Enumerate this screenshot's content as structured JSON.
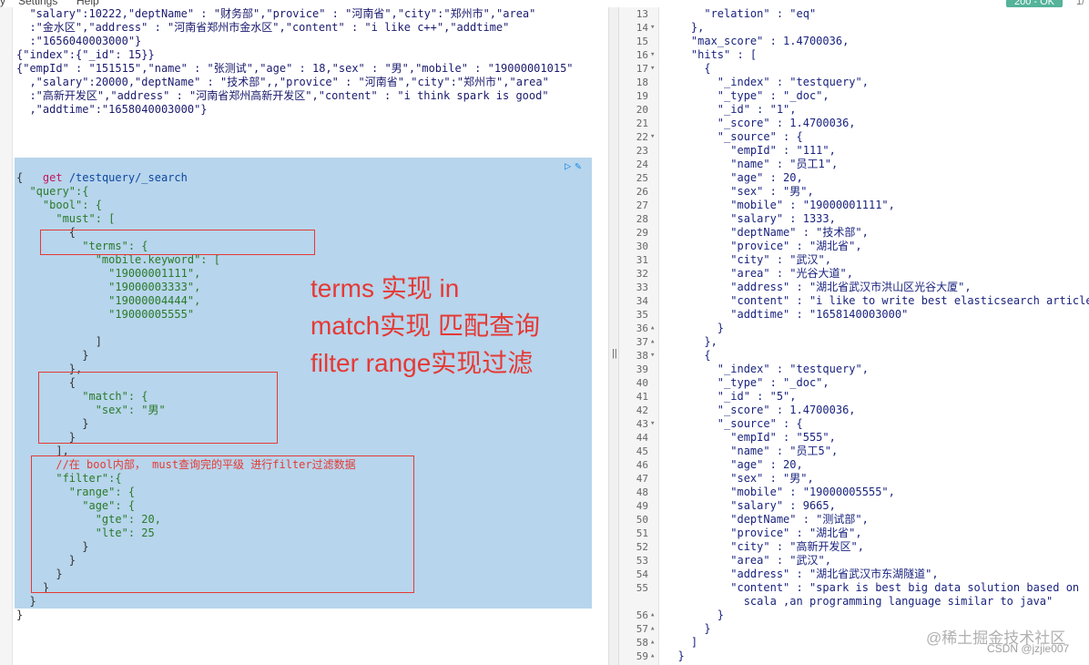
{
  "menubar": {
    "fragment": "y",
    "settings": "Settings",
    "help": "Help"
  },
  "status": {
    "badge": "200 - OK",
    "fragment": "1/"
  },
  "left": {
    "gutter_numbers": [
      "",
      "",
      "",
      "",
      "",
      "",
      "",
      "",
      "",
      "",
      "",
      "",
      "",
      "",
      "",
      "",
      "",
      "",
      "",
      "",
      "",
      "",
      "",
      "",
      "",
      "",
      "",
      "",
      "",
      "",
      "",
      "",
      "",
      "",
      "",
      "",
      "",
      "",
      "",
      "",
      "",
      "",
      "",
      "",
      ""
    ],
    "top_lines": [
      "  \"salary\":10222,\"deptName\" : \"财务部\",\"provice\" : \"河南省\",\"city\":\"郑州市\",\"area\"",
      "  :\"金水区\",\"address\" : \"河南省郑州市金水区\",\"content\" : \"i like c++\",\"addtime\"",
      "  :\"1656040003000\"}",
      "{\"index\":{\"_id\": 15}}",
      "{\"empId\" : \"151515\",\"name\" : \"张测试\",\"age\" : 18,\"sex\" : \"男\",\"mobile\" : \"19000001015\"",
      "  ,\"salary\":20000,\"deptName\" : \"技术部\",,\"provice\" : \"河南省\",\"city\":\"郑州市\",\"area\"",
      "  :\"高新开发区\",\"address\" : \"河南省郑州高新开发区\",\"content\" : \"i think spark is good\"",
      "  ,\"addtime\":\"1658040003000\"}"
    ],
    "request": {
      "method": "get",
      "url": " /testquery/_search"
    },
    "query_lines": [
      "{",
      "  \"query\":{",
      "    \"bool\": {",
      "      \"must\": [",
      "        {",
      "          \"terms\": {",
      "            \"mobile.keyword\": [",
      "              \"19000001111\",",
      "              \"19000003333\",",
      "              \"19000004444\",",
      "              \"19000005555\"",
      "",
      "            ]",
      "          }",
      "        },",
      "        {",
      "          \"match\": {",
      "            \"sex\": \"男\"",
      "          }",
      "        }",
      "      ],",
      "      //在 bool内部， must查询完的平级 进行filter过滤数据",
      "      \"filter\":{",
      "        \"range\": {",
      "          \"age\": {",
      "            \"gte\": 20,",
      "            \"lte\": 25",
      "          }",
      "        }",
      "      }",
      "    }",
      "  }",
      "}"
    ],
    "annotations": [
      "terms 实现 in",
      "match实现 匹配查询",
      "filter range实现过滤"
    ],
    "icons": {
      "run": "play-icon",
      "wrench": "wrench-icon"
    }
  },
  "right": {
    "lines": [
      {
        "num": "13",
        "fold": "",
        "text": "      \"relation\" : \"eq\""
      },
      {
        "num": "14",
        "fold": "▾",
        "text": "    },"
      },
      {
        "num": "15",
        "fold": "",
        "text": "    \"max_score\" : 1.4700036,"
      },
      {
        "num": "16",
        "fold": "▾",
        "text": "    \"hits\" : ["
      },
      {
        "num": "17",
        "fold": "▾",
        "text": "      {"
      },
      {
        "num": "18",
        "fold": "",
        "text": "        \"_index\" : \"testquery\","
      },
      {
        "num": "19",
        "fold": "",
        "text": "        \"_type\" : \"_doc\","
      },
      {
        "num": "20",
        "fold": "",
        "text": "        \"_id\" : \"1\","
      },
      {
        "num": "21",
        "fold": "",
        "text": "        \"_score\" : 1.4700036,"
      },
      {
        "num": "22",
        "fold": "▾",
        "text": "        \"_source\" : {"
      },
      {
        "num": "23",
        "fold": "",
        "text": "          \"empId\" : \"111\","
      },
      {
        "num": "24",
        "fold": "",
        "text": "          \"name\" : \"员工1\","
      },
      {
        "num": "25",
        "fold": "",
        "text": "          \"age\" : 20,"
      },
      {
        "num": "26",
        "fold": "",
        "text": "          \"sex\" : \"男\","
      },
      {
        "num": "27",
        "fold": "",
        "text": "          \"mobile\" : \"19000001111\","
      },
      {
        "num": "28",
        "fold": "",
        "text": "          \"salary\" : 1333,"
      },
      {
        "num": "29",
        "fold": "",
        "text": "          \"deptName\" : \"技术部\","
      },
      {
        "num": "30",
        "fold": "",
        "text": "          \"provice\" : \"湖北省\","
      },
      {
        "num": "31",
        "fold": "",
        "text": "          \"city\" : \"武汉\","
      },
      {
        "num": "32",
        "fold": "",
        "text": "          \"area\" : \"光谷大道\","
      },
      {
        "num": "33",
        "fold": "",
        "text": "          \"address\" : \"湖北省武汉市洪山区光谷大厦\","
      },
      {
        "num": "34",
        "fold": "",
        "text": "          \"content\" : \"i like to write best elasticsearch article\","
      },
      {
        "num": "35",
        "fold": "",
        "text": "          \"addtime\" : \"1658140003000\""
      },
      {
        "num": "36",
        "fold": "▴",
        "text": "        }"
      },
      {
        "num": "37",
        "fold": "▴",
        "text": "      },"
      },
      {
        "num": "38",
        "fold": "▾",
        "text": "      {"
      },
      {
        "num": "39",
        "fold": "",
        "text": "        \"_index\" : \"testquery\","
      },
      {
        "num": "40",
        "fold": "",
        "text": "        \"_type\" : \"_doc\","
      },
      {
        "num": "41",
        "fold": "",
        "text": "        \"_id\" : \"5\","
      },
      {
        "num": "42",
        "fold": "",
        "text": "        \"_score\" : 1.4700036,"
      },
      {
        "num": "43",
        "fold": "▾",
        "text": "        \"_source\" : {"
      },
      {
        "num": "44",
        "fold": "",
        "text": "          \"empId\" : \"555\","
      },
      {
        "num": "45",
        "fold": "",
        "text": "          \"name\" : \"员工5\","
      },
      {
        "num": "46",
        "fold": "",
        "text": "          \"age\" : 20,"
      },
      {
        "num": "47",
        "fold": "",
        "text": "          \"sex\" : \"男\","
      },
      {
        "num": "48",
        "fold": "",
        "text": "          \"mobile\" : \"19000005555\","
      },
      {
        "num": "49",
        "fold": "",
        "text": "          \"salary\" : 9665,"
      },
      {
        "num": "50",
        "fold": "",
        "text": "          \"deptName\" : \"测试部\","
      },
      {
        "num": "51",
        "fold": "",
        "text": "          \"provice\" : \"湖北省\","
      },
      {
        "num": "52",
        "fold": "",
        "text": "          \"city\" : \"高新开发区\","
      },
      {
        "num": "53",
        "fold": "",
        "text": "          \"area\" : \"武汉\","
      },
      {
        "num": "54",
        "fold": "",
        "text": "          \"address\" : \"湖北省武汉市东湖隧道\","
      },
      {
        "num": "55",
        "fold": "",
        "text": "          \"content\" : \"spark is best big data solution based on"
      },
      {
        "num": "",
        "fold": "",
        "text": "            scala ,an programming language similar to java\""
      },
      {
        "num": "56",
        "fold": "▴",
        "text": "        }"
      },
      {
        "num": "57",
        "fold": "▴",
        "text": "      }"
      },
      {
        "num": "58",
        "fold": "▴",
        "text": "    ]"
      },
      {
        "num": "59",
        "fold": "▴",
        "text": "  }"
      }
    ]
  },
  "divider": {
    "handle": "||"
  },
  "watermark": {
    "line1": "@稀土掘金技术社区",
    "line2": "CSDN @jzjie007"
  }
}
